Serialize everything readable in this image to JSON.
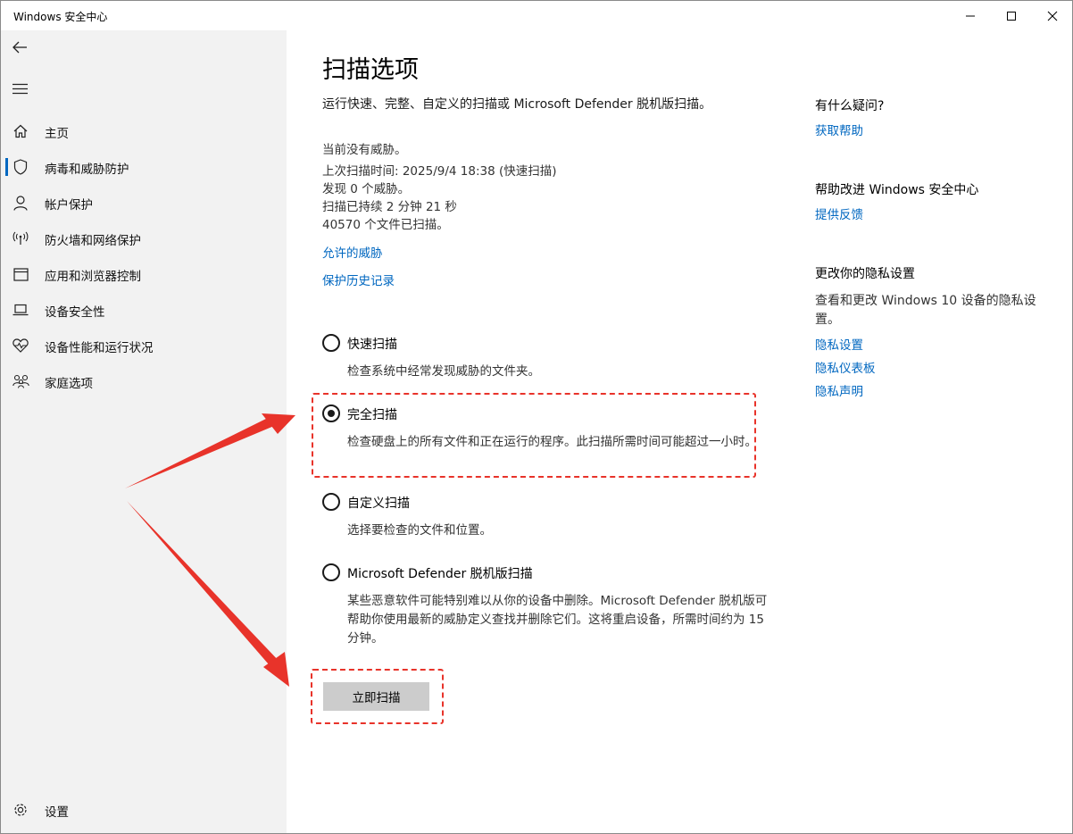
{
  "window": {
    "title": "Windows 安全中心",
    "controls": [
      "minimize",
      "maximize",
      "close"
    ]
  },
  "sidebar": {
    "back_icon": "back-arrow-icon",
    "menu_icon": "hamburger-icon",
    "items": [
      {
        "label": "主页",
        "icon": "home-icon",
        "active": false
      },
      {
        "label": "病毒和威胁防护",
        "icon": "shield-icon",
        "active": true
      },
      {
        "label": "帐户保护",
        "icon": "person-icon",
        "active": false
      },
      {
        "label": "防火墙和网络保护",
        "icon": "wifi-icon",
        "active": false
      },
      {
        "label": "应用和浏览器控制",
        "icon": "app-window-icon",
        "active": false
      },
      {
        "label": "设备安全性",
        "icon": "laptop-icon",
        "active": false
      },
      {
        "label": "设备性能和运行状况",
        "icon": "heart-pulse-icon",
        "active": false
      },
      {
        "label": "家庭选项",
        "icon": "family-icon",
        "active": false
      }
    ],
    "settings": {
      "label": "设置",
      "icon": "gear-icon"
    }
  },
  "main": {
    "title": "扫描选项",
    "description": "运行快速、完整、自定义的扫描或 Microsoft Defender 脱机版扫描。",
    "status": [
      "当前没有威胁。",
      "上次扫描时间: 2025/9/4 18:38 (快速扫描)",
      "发现 0 个威胁。",
      "扫描已持续 2 分钟 21 秒",
      "40570 个文件已扫描。"
    ],
    "links": {
      "allowed_threats": "允许的威胁",
      "protection_history": "保护历史记录"
    },
    "scan_options": [
      {
        "label": "快速扫描",
        "desc": "检查系统中经常发现威胁的文件夹。",
        "selected": false
      },
      {
        "label": "完全扫描",
        "desc": "检查硬盘上的所有文件和正在运行的程序。此扫描所需时间可能超过一小时。",
        "selected": true
      },
      {
        "label": "自定义扫描",
        "desc": "选择要检查的文件和位置。",
        "selected": false
      },
      {
        "label": "Microsoft Defender 脱机版扫描",
        "desc": "某些恶意软件可能特别难以从你的设备中删除。Microsoft Defender 脱机版可帮助你使用最新的威胁定义查找并删除它们。这将重启设备，所需时间约为 15 分钟。",
        "selected": false
      }
    ],
    "scan_button": "立即扫描"
  },
  "right_panel": {
    "question": {
      "heading": "有什么疑问?",
      "link": "获取帮助"
    },
    "improve": {
      "heading": "帮助改进 Windows 安全中心",
      "link": "提供反馈"
    },
    "privacy": {
      "heading": "更改你的隐私设置",
      "text": "查看和更改 Windows 10 设备的隐私设置。",
      "links": [
        "隐私设置",
        "隐私仪表板",
        "隐私声明"
      ]
    }
  },
  "colors": {
    "accent": "#0067c0",
    "sidebar_bg": "#f2f2f2",
    "button_bg": "#cccccc",
    "annotation_red": "#e8332a"
  }
}
